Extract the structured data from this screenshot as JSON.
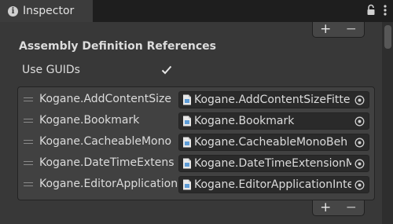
{
  "tab": {
    "title": "Inspector",
    "info_icon": "i"
  },
  "toolbar": {
    "plus": "+",
    "minus": "−"
  },
  "section_title": "Assembly Definition References",
  "use_guids": {
    "label": "Use GUIDs",
    "checked": true
  },
  "references": [
    {
      "name": "Kogane.AddContentSize",
      "value": "Kogane.AddContentSizeFitte"
    },
    {
      "name": "Kogane.Bookmark",
      "value": "Kogane.Bookmark"
    },
    {
      "name": "Kogane.CacheableMono",
      "value": "Kogane.CacheableMonoBeh"
    },
    {
      "name": "Kogane.DateTimeExtens",
      "value": "Kogane.DateTimeExtensionM"
    },
    {
      "name": "Kogane.EditorApplication",
      "value": "Kogane.EditorApplicationInte"
    }
  ],
  "colors": {
    "panel_bg": "#383838",
    "field_bg": "#2a2a2a",
    "tab_bg": "#3c3c3c"
  }
}
